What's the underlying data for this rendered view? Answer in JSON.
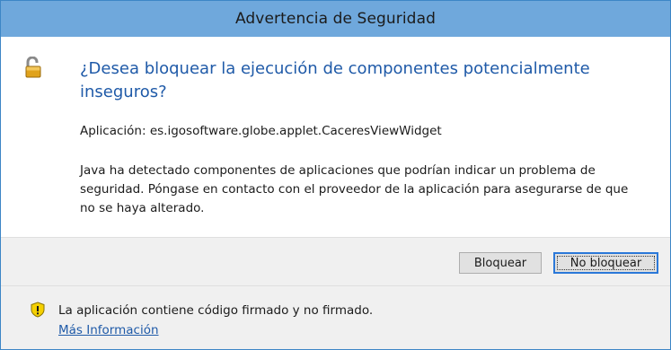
{
  "window": {
    "title": "Advertencia de Seguridad"
  },
  "main": {
    "heading": "¿Desea bloquear la ejecución de componentes potencialmente inseguros?",
    "application_line": "Aplicación: es.igosoftware.globe.applet.CaceresViewWidget",
    "description": "Java ha detectado componentes de aplicaciones que podrían indicar un problema de seguridad. Póngase en contacto con el proveedor de la aplicación para asegurarse de que no se haya alterado."
  },
  "buttons": {
    "block_label": "Bloquear",
    "no_block_label": "No bloquear"
  },
  "footer": {
    "warning_text": "La aplicación contiene código firmado y no firmado.",
    "more_info_link": "Más Información"
  },
  "icons": {
    "heading_icon": "unlocked-padlock-icon",
    "footer_icon": "warning-shield-icon"
  },
  "colors": {
    "titlebar": "#6fa8dc",
    "heading_text": "#1f5aa8",
    "link": "#1f5aa8",
    "focus_border": "#2b78d8"
  }
}
